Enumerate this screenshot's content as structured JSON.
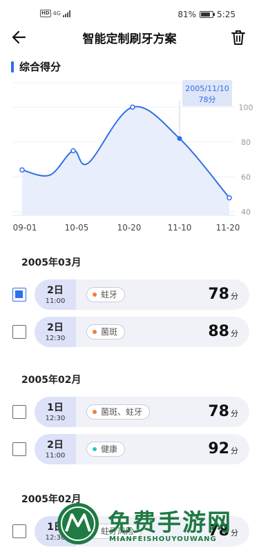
{
  "status_bar": {
    "hd": "HD",
    "network": "4G",
    "battery_percent": "81%",
    "time": "5:25"
  },
  "nav": {
    "back_icon": "arrow-left-icon",
    "title": "智能定制刷牙方案",
    "delete_icon": "trash-icon"
  },
  "section": {
    "title": "综合得分"
  },
  "chart_data": {
    "type": "line",
    "categories": [
      "09-01",
      "10-05",
      "10-20",
      "11-10",
      "11-20"
    ],
    "x": [
      "09-01",
      "09-20",
      "10-05",
      "10-12",
      "10-20",
      "11-10",
      "11-20"
    ],
    "values": [
      64,
      61,
      75,
      68,
      100,
      82,
      48
    ],
    "ylim": [
      38,
      110
    ],
    "yticks": [
      40,
      60,
      80,
      100
    ],
    "highlight": {
      "index": 5,
      "date": "2005/11/10",
      "label": "78分"
    },
    "line_color": "#2f6fe8",
    "fill_color": "#e8eefb",
    "grid": true
  },
  "groups": [
    {
      "title": "2005年03月",
      "records": [
        {
          "checked": true,
          "day": "2日",
          "time": "11:00",
          "tag": "蛀牙",
          "dot_color": "#f0813a",
          "score": "78",
          "unit": "分"
        },
        {
          "checked": false,
          "day": "2日",
          "time": "12:30",
          "tag": "菌斑",
          "dot_color": "#f0813a",
          "score": "88",
          "unit": "分"
        }
      ]
    },
    {
      "title": "2005年02月",
      "records": [
        {
          "checked": false,
          "day": "1日",
          "time": "12:30",
          "tag": "菌斑、蛀牙",
          "dot_color": "#f0813a",
          "score": "78",
          "unit": "分"
        },
        {
          "checked": false,
          "day": "2日",
          "time": "11:00",
          "tag": "健康",
          "dot_color": "#2ec4c4",
          "score": "92",
          "unit": "分"
        }
      ]
    },
    {
      "title": "2005年02月",
      "records": [
        {
          "checked": false,
          "day": "1日",
          "time": "12:30",
          "tag": "蛀牙风险",
          "dot_color": "#f0813a",
          "score": "78",
          "unit": "分"
        }
      ]
    }
  ],
  "watermark": {
    "text": "免费手游网",
    "sub": "MIANFEISHOUYOUWANG"
  }
}
